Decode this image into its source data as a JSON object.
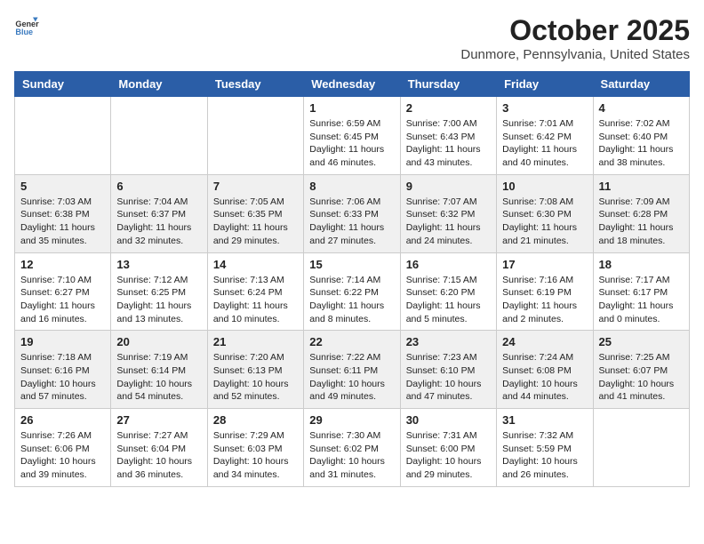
{
  "header": {
    "logo_line1": "General",
    "logo_line2": "Blue",
    "title": "October 2025",
    "subtitle": "Dunmore, Pennsylvania, United States"
  },
  "days_of_week": [
    "Sunday",
    "Monday",
    "Tuesday",
    "Wednesday",
    "Thursday",
    "Friday",
    "Saturday"
  ],
  "weeks": [
    [
      {
        "day": "",
        "info": ""
      },
      {
        "day": "",
        "info": ""
      },
      {
        "day": "",
        "info": ""
      },
      {
        "day": "1",
        "info": "Sunrise: 6:59 AM\nSunset: 6:45 PM\nDaylight: 11 hours\nand 46 minutes."
      },
      {
        "day": "2",
        "info": "Sunrise: 7:00 AM\nSunset: 6:43 PM\nDaylight: 11 hours\nand 43 minutes."
      },
      {
        "day": "3",
        "info": "Sunrise: 7:01 AM\nSunset: 6:42 PM\nDaylight: 11 hours\nand 40 minutes."
      },
      {
        "day": "4",
        "info": "Sunrise: 7:02 AM\nSunset: 6:40 PM\nDaylight: 11 hours\nand 38 minutes."
      }
    ],
    [
      {
        "day": "5",
        "info": "Sunrise: 7:03 AM\nSunset: 6:38 PM\nDaylight: 11 hours\nand 35 minutes."
      },
      {
        "day": "6",
        "info": "Sunrise: 7:04 AM\nSunset: 6:37 PM\nDaylight: 11 hours\nand 32 minutes."
      },
      {
        "day": "7",
        "info": "Sunrise: 7:05 AM\nSunset: 6:35 PM\nDaylight: 11 hours\nand 29 minutes."
      },
      {
        "day": "8",
        "info": "Sunrise: 7:06 AM\nSunset: 6:33 PM\nDaylight: 11 hours\nand 27 minutes."
      },
      {
        "day": "9",
        "info": "Sunrise: 7:07 AM\nSunset: 6:32 PM\nDaylight: 11 hours\nand 24 minutes."
      },
      {
        "day": "10",
        "info": "Sunrise: 7:08 AM\nSunset: 6:30 PM\nDaylight: 11 hours\nand 21 minutes."
      },
      {
        "day": "11",
        "info": "Sunrise: 7:09 AM\nSunset: 6:28 PM\nDaylight: 11 hours\nand 18 minutes."
      }
    ],
    [
      {
        "day": "12",
        "info": "Sunrise: 7:10 AM\nSunset: 6:27 PM\nDaylight: 11 hours\nand 16 minutes."
      },
      {
        "day": "13",
        "info": "Sunrise: 7:12 AM\nSunset: 6:25 PM\nDaylight: 11 hours\nand 13 minutes."
      },
      {
        "day": "14",
        "info": "Sunrise: 7:13 AM\nSunset: 6:24 PM\nDaylight: 11 hours\nand 10 minutes."
      },
      {
        "day": "15",
        "info": "Sunrise: 7:14 AM\nSunset: 6:22 PM\nDaylight: 11 hours\nand 8 minutes."
      },
      {
        "day": "16",
        "info": "Sunrise: 7:15 AM\nSunset: 6:20 PM\nDaylight: 11 hours\nand 5 minutes."
      },
      {
        "day": "17",
        "info": "Sunrise: 7:16 AM\nSunset: 6:19 PM\nDaylight: 11 hours\nand 2 minutes."
      },
      {
        "day": "18",
        "info": "Sunrise: 7:17 AM\nSunset: 6:17 PM\nDaylight: 11 hours\nand 0 minutes."
      }
    ],
    [
      {
        "day": "19",
        "info": "Sunrise: 7:18 AM\nSunset: 6:16 PM\nDaylight: 10 hours\nand 57 minutes."
      },
      {
        "day": "20",
        "info": "Sunrise: 7:19 AM\nSunset: 6:14 PM\nDaylight: 10 hours\nand 54 minutes."
      },
      {
        "day": "21",
        "info": "Sunrise: 7:20 AM\nSunset: 6:13 PM\nDaylight: 10 hours\nand 52 minutes."
      },
      {
        "day": "22",
        "info": "Sunrise: 7:22 AM\nSunset: 6:11 PM\nDaylight: 10 hours\nand 49 minutes."
      },
      {
        "day": "23",
        "info": "Sunrise: 7:23 AM\nSunset: 6:10 PM\nDaylight: 10 hours\nand 47 minutes."
      },
      {
        "day": "24",
        "info": "Sunrise: 7:24 AM\nSunset: 6:08 PM\nDaylight: 10 hours\nand 44 minutes."
      },
      {
        "day": "25",
        "info": "Sunrise: 7:25 AM\nSunset: 6:07 PM\nDaylight: 10 hours\nand 41 minutes."
      }
    ],
    [
      {
        "day": "26",
        "info": "Sunrise: 7:26 AM\nSunset: 6:06 PM\nDaylight: 10 hours\nand 39 minutes."
      },
      {
        "day": "27",
        "info": "Sunrise: 7:27 AM\nSunset: 6:04 PM\nDaylight: 10 hours\nand 36 minutes."
      },
      {
        "day": "28",
        "info": "Sunrise: 7:29 AM\nSunset: 6:03 PM\nDaylight: 10 hours\nand 34 minutes."
      },
      {
        "day": "29",
        "info": "Sunrise: 7:30 AM\nSunset: 6:02 PM\nDaylight: 10 hours\nand 31 minutes."
      },
      {
        "day": "30",
        "info": "Sunrise: 7:31 AM\nSunset: 6:00 PM\nDaylight: 10 hours\nand 29 minutes."
      },
      {
        "day": "31",
        "info": "Sunrise: 7:32 AM\nSunset: 5:59 PM\nDaylight: 10 hours\nand 26 minutes."
      },
      {
        "day": "",
        "info": ""
      }
    ]
  ]
}
